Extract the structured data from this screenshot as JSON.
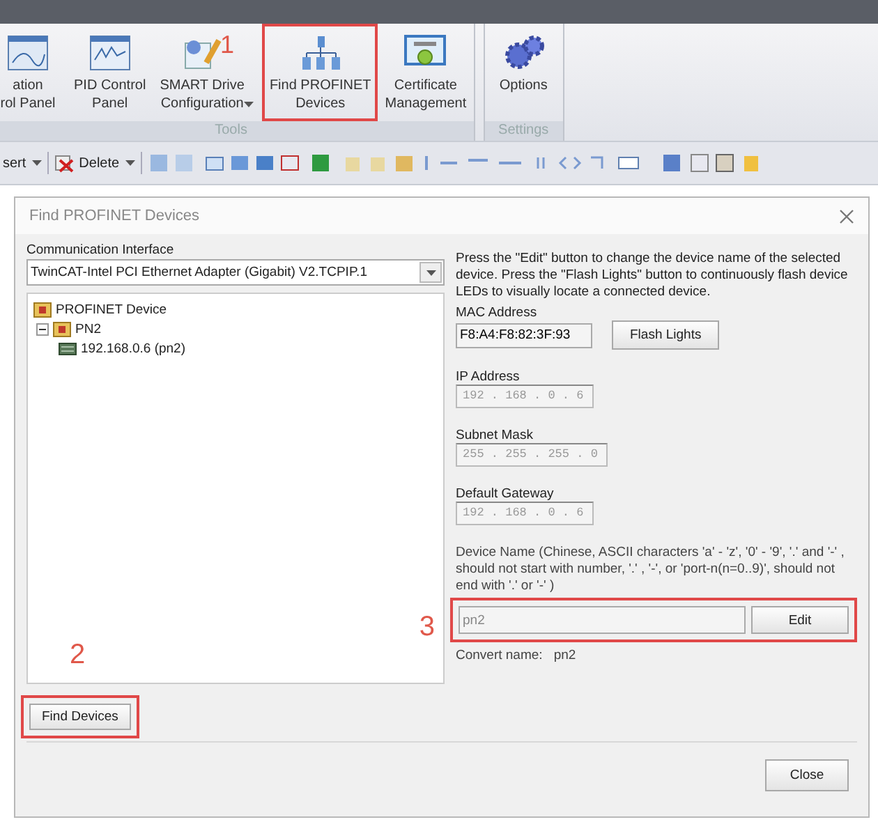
{
  "ribbon": {
    "groups": [
      {
        "label": "Tools",
        "buttons": [
          {
            "label": "ation\nrol Panel",
            "highlighted": false,
            "dropdown": false
          },
          {
            "label": "PID Control\nPanel",
            "highlighted": false,
            "dropdown": false
          },
          {
            "label": "SMART Drive\nConfiguration",
            "highlighted": false,
            "dropdown": true
          },
          {
            "label": "Find PROFINET\nDevices",
            "highlighted": true,
            "dropdown": false
          },
          {
            "label": "Certificate\nManagement",
            "highlighted": false,
            "dropdown": false
          }
        ]
      },
      {
        "label": "Settings",
        "buttons": [
          {
            "label": "Options",
            "highlighted": false,
            "dropdown": false
          }
        ]
      }
    ]
  },
  "toolbar": {
    "items": [
      {
        "label": "sert"
      },
      {
        "label": "Delete"
      }
    ]
  },
  "callouts": [
    "1",
    "2",
    "3"
  ],
  "dialog": {
    "title": "Find PROFINET Devices",
    "interface_label": "Communication Interface",
    "interface_value": "TwinCAT-Intel PCI Ethernet Adapter (Gigabit) V2.TCPIP.1",
    "tree": [
      {
        "label": "PROFINET Device",
        "children": [
          {
            "label": "PN2",
            "expanded": true,
            "children": [
              {
                "label": "192.168.0.6 (pn2)"
              }
            ]
          }
        ]
      }
    ],
    "help_text": "Press the \"Edit\" button to change the device name of the selected device. Press the \"Flash Lights\" button to continuously flash device LEDs to visually locate a connected device.",
    "mac_label": "MAC Address",
    "mac_value": "F8:A4:F8:82:3F:93",
    "flash_button": "Flash Lights",
    "ip_fields": [
      {
        "label": "IP Address",
        "value": "192 . 168 . 0 . 6"
      },
      {
        "label": "Subnet Mask",
        "value": "255 . 255 . 255 . 0"
      },
      {
        "label": "Default Gateway",
        "value": "192 . 168 . 0 . 6"
      }
    ],
    "name_rules": "Device Name (Chinese, ASCII characters 'a' - 'z', '0' - '9', '.' and '-' , should not start with number, '.' , '-', or 'port-n(n=0..9)', should not end with '.' or '-' )",
    "name_value": "pn2",
    "name_highlighted": true,
    "edit_button": "Edit",
    "convert_label": "Convert name:",
    "convert_value": "pn2",
    "find_button": "Find Devices",
    "find_highlighted": true,
    "close_button": "Close"
  }
}
